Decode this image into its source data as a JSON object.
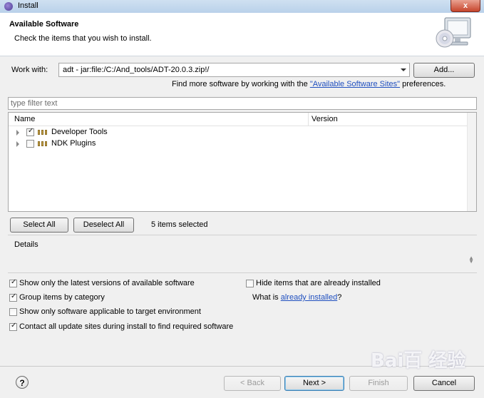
{
  "window": {
    "title": "Install",
    "close_label": "x"
  },
  "header": {
    "title": "Available Software",
    "subtitle": "Check the items that you wish to install.",
    "icon": "monitor-cd-icon"
  },
  "work_with": {
    "label": "Work with:",
    "value": "adt - jar:file:/C:/And_tools/ADT-20.0.3.zip!/",
    "add_button": "Add..."
  },
  "find_more": {
    "prefix": "Find more software by working with the ",
    "link": "\"Available Software Sites\"",
    "suffix": " preferences."
  },
  "filter": {
    "placeholder": "type filter text"
  },
  "tree": {
    "columns": {
      "name": "Name",
      "version": "Version"
    },
    "items": [
      {
        "label": "Developer Tools",
        "checked": true,
        "expanded": false
      },
      {
        "label": "NDK Plugins",
        "checked": false,
        "expanded": false
      }
    ]
  },
  "selection": {
    "select_all": "Select All",
    "deselect_all": "Deselect All",
    "status": "5 items selected"
  },
  "details": {
    "label": "Details"
  },
  "options": {
    "show_latest": {
      "label": "Show only the latest versions of available software",
      "checked": true
    },
    "hide_installed": {
      "label": "Hide items that are already installed",
      "checked": false
    },
    "group_by_category": {
      "label": "Group items by category",
      "checked": true
    },
    "what_is_prefix": "What is ",
    "already_installed_link": "already installed",
    "what_is_suffix": "?",
    "target_env": {
      "label": "Show only software applicable to target environment",
      "checked": false
    },
    "contact_sites": {
      "label": "Contact all update sites during install to find required software",
      "checked": true
    }
  },
  "footer": {
    "help": "?",
    "back": "< Back",
    "next": "Next >",
    "finish": "Finish",
    "cancel": "Cancel"
  },
  "watermark": "Bai百 经验"
}
